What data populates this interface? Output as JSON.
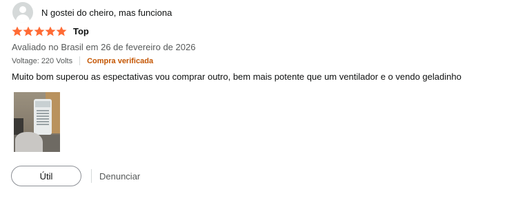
{
  "review": {
    "profile_name": "N gostei do cheiro, mas funciona",
    "avatar_icon": "user-avatar-icon",
    "rating": 5,
    "rating_max": 5,
    "star_color": "#ff6b35",
    "title": "Top",
    "date": "Avaliado no Brasil em 26 de fevereiro de 2026",
    "variant": "Voltage: 220 Volts",
    "verified": "Compra verificada",
    "verified_color": "#c45500",
    "body": "Muito bom superou as espectativas vou comprar outro, bem mais potente que um ventilador e o vendo geladinho",
    "image_alt": "air-cooler-photo",
    "helpful_label": "Útil",
    "report_label": "Denunciar"
  }
}
